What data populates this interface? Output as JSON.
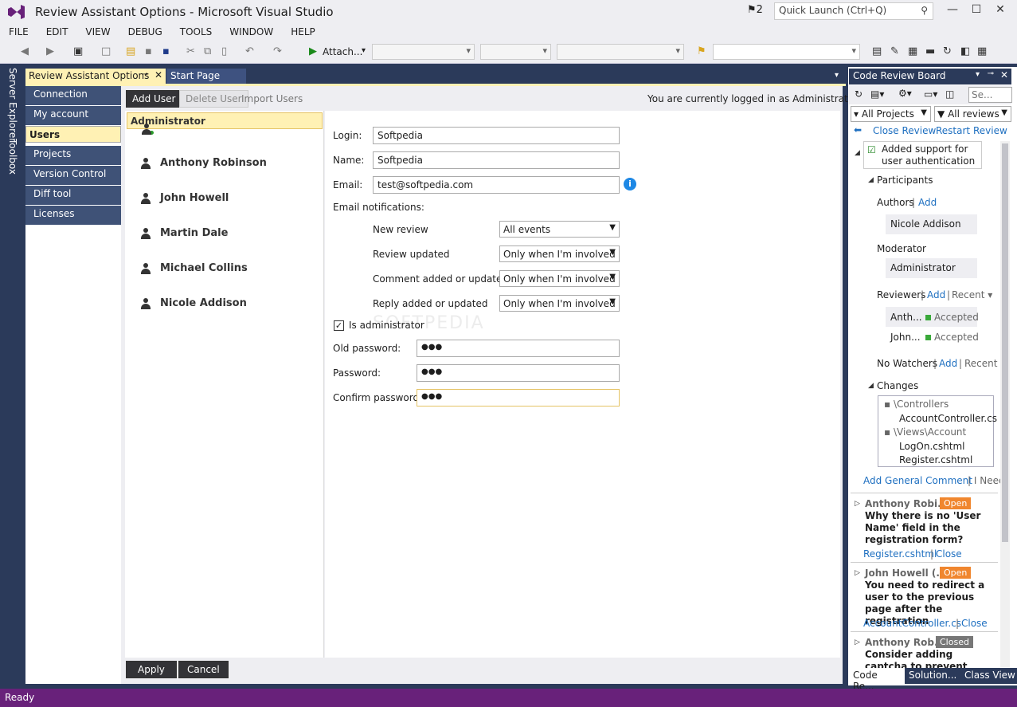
{
  "window": {
    "title": "Review Assistant Options - Microsoft Visual Studio",
    "notif_count": "2",
    "quick_launch": "Quick Launch (Ctrl+Q)"
  },
  "menu": [
    "FILE",
    "EDIT",
    "VIEW",
    "DEBUG",
    "TOOLS",
    "WINDOW",
    "HELP"
  ],
  "toolbar": {
    "attach_label": "Attach..."
  },
  "left_tabs": {
    "server_explorer": "Server Explorer",
    "toolbox": "Toolbox"
  },
  "tabs": {
    "active": "Review Assistant Options",
    "second": "Start Page"
  },
  "nav": [
    "Connection",
    "My account",
    "Users",
    "Projects",
    "Version Control",
    "Diff tool",
    "Licenses"
  ],
  "actions": {
    "add_user": "Add User",
    "delete_user": "Delete User",
    "import_users": "Import Users",
    "logged_in": "You are currently logged in as Administrator."
  },
  "users": [
    "Administrator",
    "Anthony Robinson",
    "John Howell",
    "Martin Dale",
    "Michael Collins",
    "Nicole Addison"
  ],
  "form": {
    "login_label": "Login:",
    "login_value": "Softpedia",
    "name_label": "Name:",
    "name_value": "Softpedia",
    "email_label": "Email:",
    "email_value": "test@softpedia.com",
    "notif_label": "Email notifications:",
    "notifs": [
      {
        "label": "New review",
        "value": "All events"
      },
      {
        "label": "Review updated",
        "value": "Only when I'm involved"
      },
      {
        "label": "Comment added or updated",
        "value": "Only when I'm involved"
      },
      {
        "label": "Reply added or updated",
        "value": "Only when I'm involved"
      }
    ],
    "admin_label": "Is administrator",
    "old_pw_label": "Old password:",
    "old_pw": "●●●",
    "pw_label": "Password:",
    "pw": "●●●",
    "confirm_label": "Confirm password:",
    "confirm": "●●●",
    "watermark": "SOFTPEDIA"
  },
  "footer": {
    "apply": "Apply",
    "cancel": "Cancel"
  },
  "board": {
    "title": "Code Review Board",
    "search_placeholder": "Se...",
    "projects": "All Projects",
    "reviews": "All reviews",
    "close_review": "Close Review",
    "restart_review": "Restart Review",
    "review_title": "Added support for user authentication",
    "participants": "Participants",
    "authors": "Authors",
    "add": "Add",
    "author_name": "Nicole Addison",
    "moderator": "Moderator",
    "moderator_name": "Administrator",
    "reviewers": "Reviewers",
    "recent": "Recent",
    "rev1": "Anth...",
    "rev2": "John...",
    "accepted": "Accepted",
    "no_watchers": "No Watchers",
    "changes": "Changes",
    "folder1": "\\Controllers",
    "file1": "AccountController.cs",
    "folder2": "\\Views\\Account",
    "file2": "LogOn.cshtml",
    "file3": "Register.cshtml",
    "add_comment": "Add General Comment",
    "need": "I Need",
    "comments": [
      {
        "author": "Anthony Robi...",
        "status": "Open",
        "text": "Why there is no 'User Name' field in the registration form?",
        "file": "Register.cshtml",
        "close": "Close"
      },
      {
        "author": "John Howell (...",
        "status": "Open",
        "text": "You need to redirect a user to the previous page after the registration",
        "file": "AccountController.cs",
        "close": "Close"
      },
      {
        "author": "Anthony Rob...",
        "status": "Closed",
        "text": "Consider adding captcha to prevent robotic registration"
      }
    ],
    "bottom_tabs": [
      "Code Re...",
      "Solution...",
      "Class View"
    ]
  },
  "status": "Ready",
  "colors": {
    "status_bar": "#68217a",
    "selected": "#fff1b4",
    "nav": "#3f5277",
    "link": "#1e6fc0"
  }
}
